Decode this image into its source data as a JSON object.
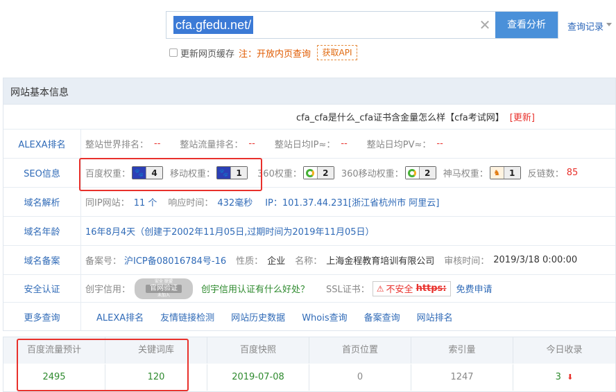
{
  "search": {
    "value": "cfa.gfedu.net/",
    "analyze_label": "查看分析",
    "history_label": "查询记录",
    "cache_label": "更新网页缓存",
    "note_label": "注：开放内页查询",
    "api_label": "获取API",
    "clear_icon": "close-icon"
  },
  "panel": {
    "title": "网站基本信息",
    "site_title": "cfa_cfa是什么_cfa证书含金量怎么样【cfa考试网】",
    "update_label": "[更新]",
    "rows": {
      "alexa": {
        "label": "ALEXA排名",
        "world_rank_label": "整站世界排名：",
        "world_rank": "--",
        "traffic_rank_label": "整站流量排名：",
        "traffic_rank": "--",
        "daily_ip_label": "整站日均IP≈：",
        "daily_ip": "--",
        "daily_pv_label": "整站日均PV≈：",
        "daily_pv": "--"
      },
      "seo": {
        "label": "SEO信息",
        "baidu_weight_label": "百度权重：",
        "baidu_weight": "4",
        "mobile_weight_label": "移动权重：",
        "mobile_weight": "1",
        "w360_label": "360权重：",
        "w360": "2",
        "m360_label": "360移动权重：",
        "m360": "2",
        "shenma_label": "神马权重：",
        "shenma": "1",
        "backlinks_label": "反链数：",
        "backlinks": "85"
      },
      "dns": {
        "label": "域名解析",
        "same_ip_label": "同IP网站：",
        "same_ip": "11 个",
        "response_label": "响应时间：",
        "response": "432毫秒",
        "ip": "IP：101.37.44.231[浙江省杭州市 阿里云]"
      },
      "age": {
        "label": "域名年龄",
        "text": "16年8月4天（创建于2002年11月05日,过期时间为2019年11月05日）"
      },
      "icp": {
        "label": "域名备案",
        "icp_no_label": "备案号：",
        "icp_no": "沪ICP备08016784号-16",
        "nature_label": "性质：",
        "nature": "企业",
        "name_label": "名称：",
        "name": "上海金程教育培训有限公司",
        "audit_label": "审核时间：",
        "audit": "2019/3/18 0:00:00"
      },
      "security": {
        "label": "安全认证",
        "cx_label": "创宇信用：",
        "seal_top": "安全 联盟",
        "seal_main": "官网验证",
        "seal_bottom": "未加入",
        "cx_link": "创宇信用认证有什么好处？",
        "ssl_label": "SSL证书：",
        "ssl_status": "不安全",
        "ssl_proto": "https:",
        "ssl_apply": "免费申请"
      },
      "more": {
        "label": "更多查询",
        "links": [
          "ALEXA排名",
          "友情链接检测",
          "网站历史数据",
          "Whois查询",
          "备案查询",
          "网站排名"
        ]
      }
    }
  },
  "table": {
    "headers": [
      "百度流量预计",
      "关键词库",
      "百度快照",
      "首页位置",
      "索引量",
      "今日收录"
    ],
    "values": [
      "2495",
      "120",
      "2019-07-08",
      "0",
      "1247",
      "3"
    ],
    "trend_icon": "arrow-down-icon"
  },
  "colors": {
    "accent": "#4a90d9",
    "highlight": "#e8302b",
    "link": "#2f6ab7",
    "good": "#2e8a2e"
  }
}
